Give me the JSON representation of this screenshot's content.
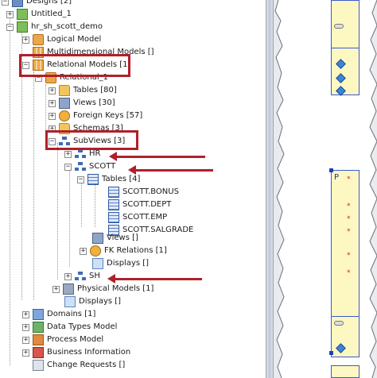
{
  "tree": {
    "designs": "Designs [2]",
    "untitled": "Untitled_1",
    "hr_sh_scott": "hr_sh_scott_demo",
    "logical_model": "Logical Model",
    "multidimensional": "Multidimensional Models []",
    "relational_models": "Relational Models [1]",
    "relational_1": "Relational_1",
    "tables": "Tables [80]",
    "views": "Views [30]",
    "foreign_keys": "Foreign Keys [57]",
    "schemas": "Schemas [3]",
    "subviews": "SubViews [3]",
    "hr": "HR",
    "scott": "SCOTT",
    "scott_tables": "Tables [4]",
    "scott_table_items": [
      "SCOTT.BONUS",
      "SCOTT.DEPT",
      "SCOTT.EMP",
      "SCOTT.SALGRADE"
    ],
    "scott_views": "Views []",
    "fk_relations": "FK Relations [1]",
    "scott_displays": "Displays []",
    "sh": "SH",
    "physical_models": "Physical Models [1]",
    "relational_displays": "Displays []",
    "domains": "Domains [1]",
    "data_types": "Data Types Model",
    "process_model": "Process Model",
    "business_info": "Business Information",
    "change_requests": "Change Requests []"
  },
  "expander": {
    "plus": "+",
    "minus": "−"
  },
  "diagram": {
    "entity_label": "P"
  },
  "colors": {
    "highlight": "#b0202a",
    "entity_fill": "#fdf7c2",
    "entity_border": "#3a5ad0"
  },
  "icons": [
    "designs-icon",
    "design-icon",
    "logical-model-icon",
    "relational-model-icon",
    "folder-icon",
    "table-icon",
    "view-icon",
    "foreign-key-icon",
    "subview-icon",
    "display-icon",
    "physical-model-icon",
    "domain-icon",
    "data-types-icon",
    "process-model-icon",
    "business-info-icon",
    "change-request-icon"
  ]
}
